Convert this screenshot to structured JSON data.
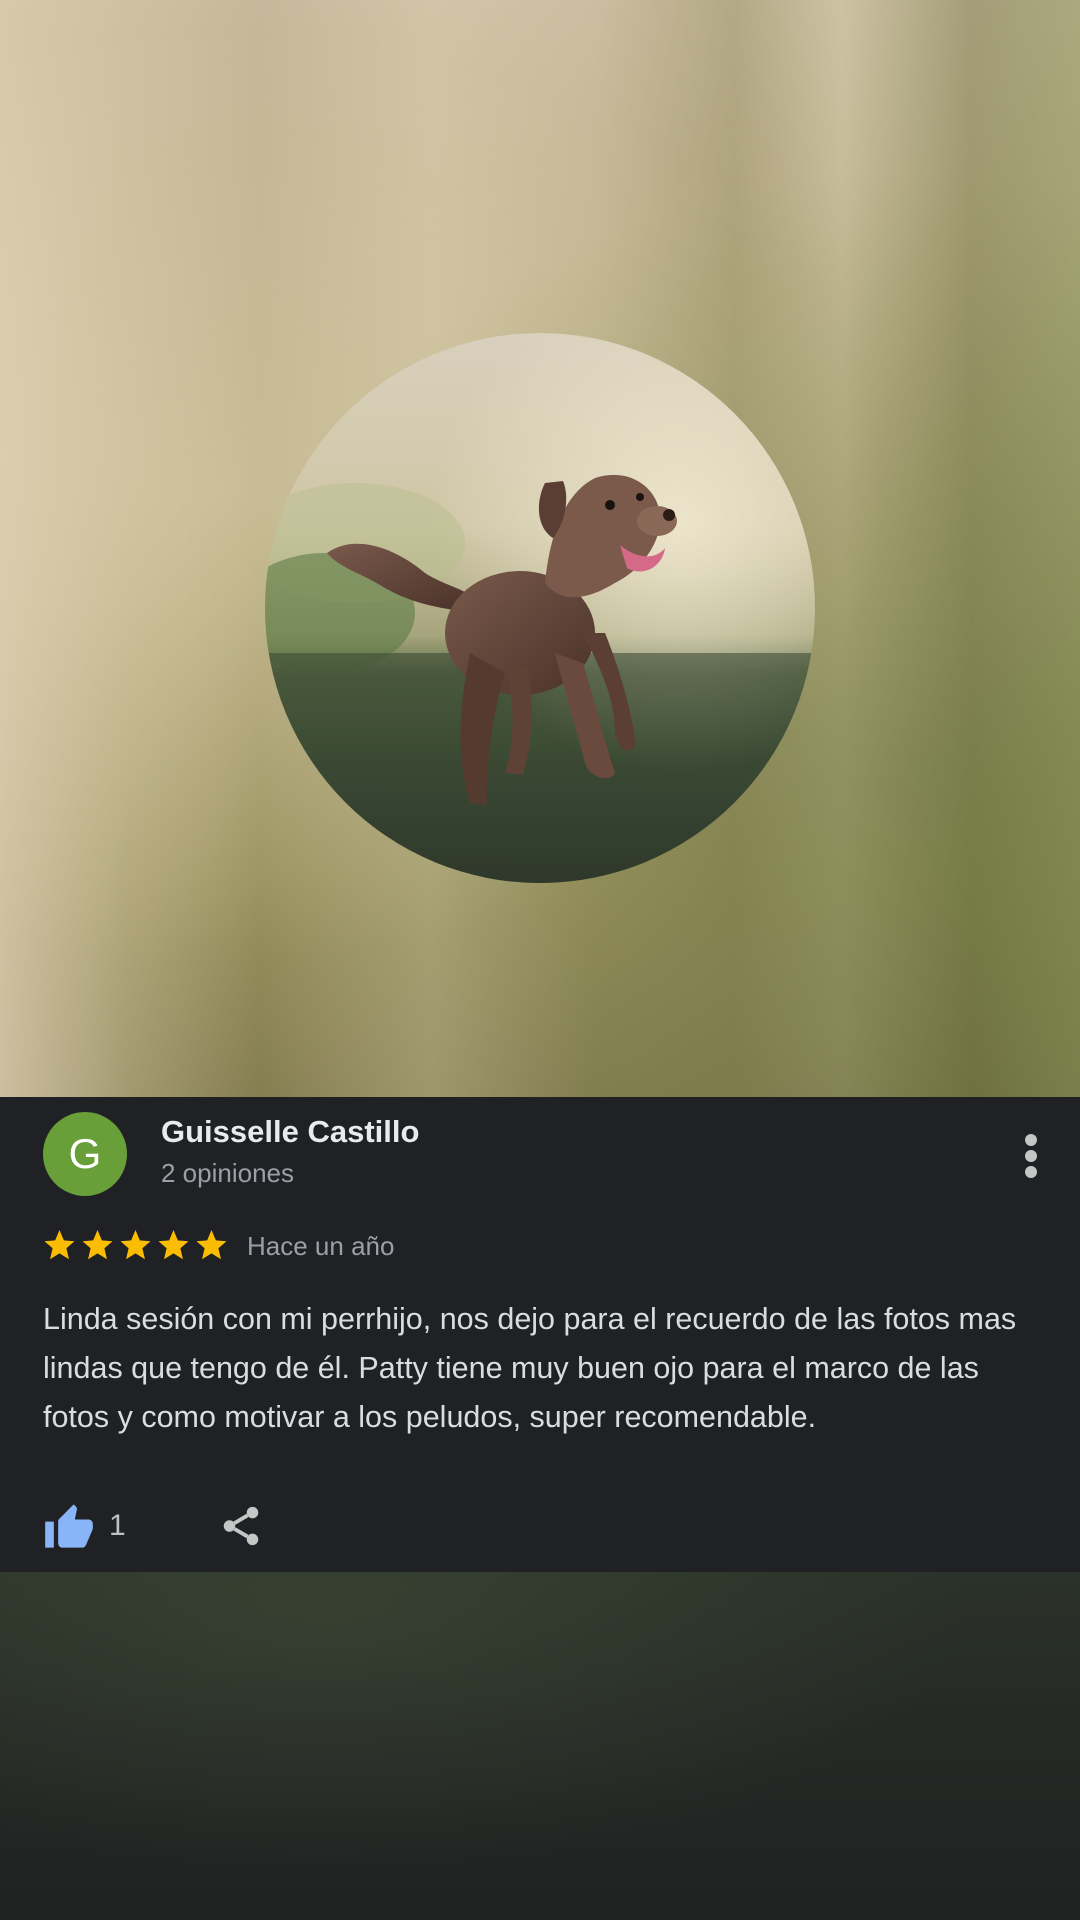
{
  "colors": {
    "card_background": "#202125",
    "avatar_background": "#689f38",
    "star": "#fbbc04",
    "like_icon": "#8ab4f8",
    "primary_text": "#e8eaed",
    "secondary_text": "#9aa0a6"
  },
  "photo": {
    "icon": "dog-photo"
  },
  "review": {
    "avatar_letter": "G",
    "author_name": "Guisselle Castillo",
    "author_reviews": "2 opiniones",
    "rating": 5,
    "rating_max": 5,
    "time": "Hace un año",
    "text": "Linda sesión con mi perrhijo, nos dejo para el recuerdo de las fotos mas lindas que tengo de él. Patty tiene muy buen ojo para el marco de las fotos y como motivar a los peludos, super recomendable.",
    "likes": "1"
  },
  "icons": {
    "more": "more-vert-icon",
    "like": "thumb-up-icon",
    "share": "share-icon",
    "star": "star-icon"
  }
}
